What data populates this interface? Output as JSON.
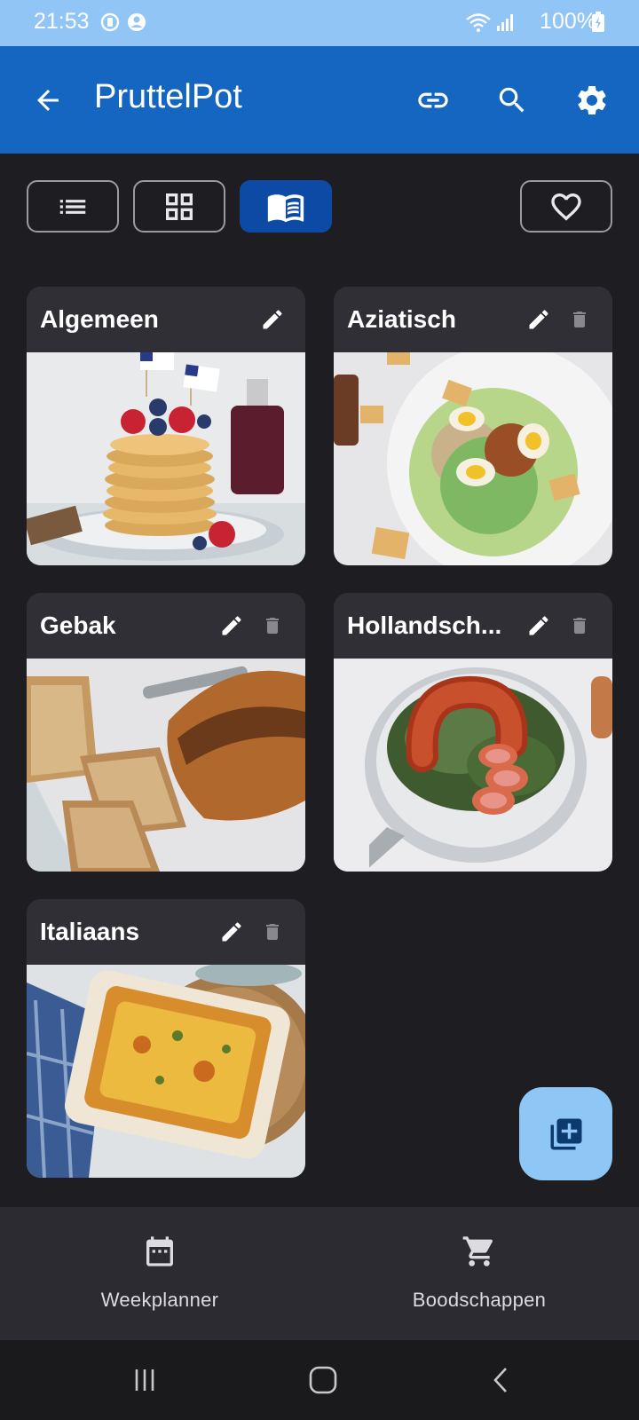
{
  "status_bar": {
    "time": "21:53",
    "battery": "100%"
  },
  "app_bar": {
    "title": "PruttelPot",
    "back_icon": "arrow-back-icon",
    "link_icon": "link-icon",
    "search_icon": "search-icon",
    "settings_icon": "gear-icon",
    "color": "#1566c0"
  },
  "view_toggles": {
    "items": [
      "list-view",
      "grid-view",
      "book-view",
      "favorites"
    ],
    "active": "book-view"
  },
  "categories": [
    {
      "title": "Algemeen",
      "image": "pancakes-photo"
    },
    {
      "title": "Aziatisch",
      "image": "salad-photo"
    },
    {
      "title": "Gebak",
      "image": "banana-bread-photo"
    },
    {
      "title": "Hollandsch...",
      "image": "kale-sausage-photo"
    },
    {
      "title": "Italiaans",
      "image": "lasagna-photo"
    }
  ],
  "fab": {
    "icon": "add-library-icon",
    "color": "#8ec6f5"
  },
  "bottom_nav": {
    "weekplanner": "Weekplanner",
    "boodschappen": "Boodschappen"
  }
}
